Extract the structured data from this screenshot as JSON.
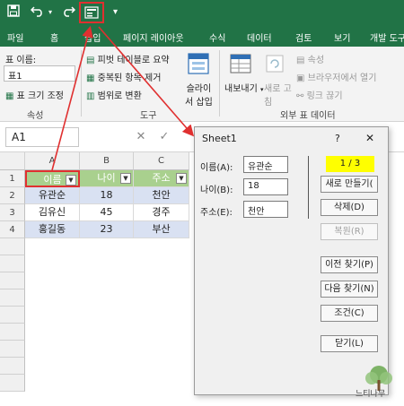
{
  "quick_access": {
    "save_icon": "save-icon",
    "undo_icon": "undo-icon",
    "redo_icon": "redo-icon",
    "form_icon": "form-icon",
    "dropdown_icon": "dropdown-icon"
  },
  "ribbon_tabs": [
    "파일",
    "홈",
    "삽입",
    "페이지 레이아웃",
    "수식",
    "데이터",
    "검토",
    "보기",
    "개발 도구"
  ],
  "ribbon": {
    "table_name_label": "표 이름:",
    "table_name_value": "표1",
    "resize_table": "표 크기 조정",
    "group_properties": "속성",
    "pivot": "피벗 테이블로 요약",
    "remove_duplicates": "중복된 항목 제거",
    "convert_range": "범위로 변환",
    "group_tools": "도구",
    "slicer_line1": "슬라이",
    "slicer_line2": "서 삽입",
    "export": "내보내기",
    "refresh_line1": "새로 고",
    "refresh_line2": "침",
    "properties_item": "속성",
    "open_in_browser": "브라우저에서 열기",
    "unlink": "링크 끊기",
    "group_external": "외부 표 데이터"
  },
  "formula_bar": {
    "name_box": "A1",
    "cancel": "✕",
    "enter": "✓"
  },
  "sheet": {
    "columns": [
      "A",
      "B",
      "C"
    ],
    "rows": [
      "1",
      "2",
      "3",
      "4"
    ],
    "headers": [
      "이름",
      "나이",
      "주소"
    ],
    "data": [
      [
        "유관순",
        "18",
        "천안"
      ],
      [
        "김유신",
        "45",
        "경주"
      ],
      [
        "홍길동",
        "23",
        "부산"
      ]
    ]
  },
  "dialog": {
    "title": "Sheet1",
    "help": "?",
    "close": "✕",
    "counter": "1 / 3",
    "fields": [
      {
        "label": "이름(A):",
        "value": "유관순"
      },
      {
        "label": "나이(B):",
        "value": "18"
      },
      {
        "label": "주소(E):",
        "value": "천안"
      }
    ],
    "buttons": [
      {
        "label": "새로 만들기(",
        "disabled": false
      },
      {
        "label": "삭제(D)",
        "disabled": false
      },
      {
        "label": "복원(R)",
        "disabled": true
      },
      {
        "label": "이전 찾기(P)",
        "disabled": false
      },
      {
        "label": "다음 찾기(N)",
        "disabled": false
      },
      {
        "label": "조건(C)",
        "disabled": false
      },
      {
        "label": "닫기(L)",
        "disabled": false
      }
    ]
  },
  "watermark": "느티나무",
  "colors": {
    "excel_green": "#217346",
    "header_green": "#a9d08e",
    "row_blue": "#d9e1f2",
    "highlight_red": "#e03030",
    "counter_yellow": "#ffff00"
  }
}
